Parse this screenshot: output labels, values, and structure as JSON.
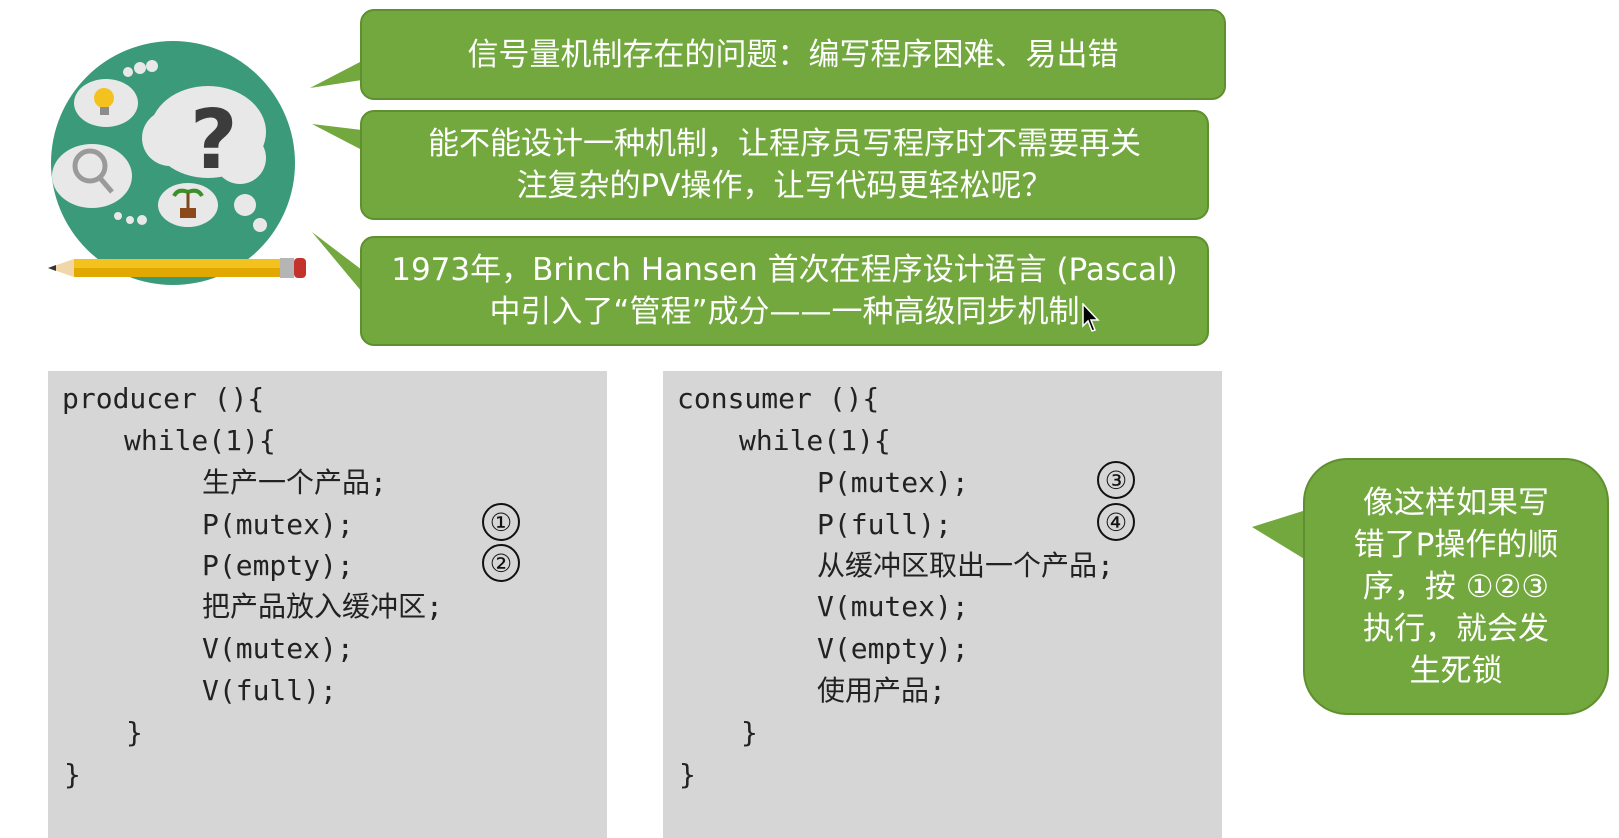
{
  "bubbles": {
    "b1": "信号量机制存在的问题：编写程序困难、易出错",
    "b2_line1": "能不能设计一种机制，让程序员写程序时不需要再关",
    "b2_line2": "注复杂的PV操作，让写代码更轻松呢？",
    "b3_line1": "1973年，Brinch Hansen 首次在程序设计语言 (Pascal)",
    "b3_line2": "中引入了“管程”成分——一种高级同步机制",
    "side_line1": "像这样如果写",
    "side_line2": "错了P操作的顺",
    "side_line3": "序，按 ①②③",
    "side_line4": "执行，就会发",
    "side_line5": "生死锁"
  },
  "producer": {
    "lines": [
      "producer (){",
      "while(1){",
      "生产一个产品;",
      "P(mutex);",
      "P(empty);",
      "把产品放入缓冲区;",
      "V(mutex);",
      "V(full);",
      "}",
      "}"
    ],
    "markers": [
      "①",
      "②"
    ]
  },
  "consumer": {
    "lines": [
      "consumer (){",
      "while(1){",
      "P(mutex);",
      "P(full);",
      "从缓冲区取出一个产品;",
      "V(mutex);",
      "V(empty);",
      "使用产品;",
      "}",
      "}"
    ],
    "markers": [
      "③",
      "④"
    ]
  },
  "colors": {
    "bubble_green": "#72a83d",
    "code_bg": "#d6d6d6",
    "illustration_teal": "#3a9a7a"
  }
}
